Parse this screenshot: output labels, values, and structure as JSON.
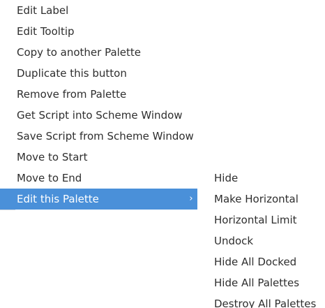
{
  "main_menu": {
    "items": [
      {
        "label": "Edit Label"
      },
      {
        "label": "Edit Tooltip"
      },
      {
        "label": "Copy to another Palette"
      },
      {
        "label": "Duplicate this button"
      },
      {
        "label": "Remove from Palette"
      },
      {
        "label": "Get Script into Scheme Window"
      },
      {
        "label": "Save Script from Scheme Window"
      },
      {
        "label": "Move to Start"
      },
      {
        "label": "Move to End"
      },
      {
        "label": "Edit this Palette",
        "has_submenu": true,
        "highlighted": true
      }
    ]
  },
  "submenu": {
    "items": [
      {
        "label": "Hide"
      },
      {
        "label": "Make Horizontal"
      },
      {
        "label": "Horizontal Limit"
      },
      {
        "label": "Undock"
      },
      {
        "label": "Hide All Docked"
      },
      {
        "label": "Hide All Palettes"
      },
      {
        "label": "Destroy All Palettes"
      }
    ]
  },
  "icons": {
    "submenu_arrow": "chevron-right-icon"
  },
  "colors": {
    "highlight": "#4a90d9",
    "text": "#2e2e2e",
    "highlight_text": "#ffffff",
    "background": "#ffffff"
  }
}
